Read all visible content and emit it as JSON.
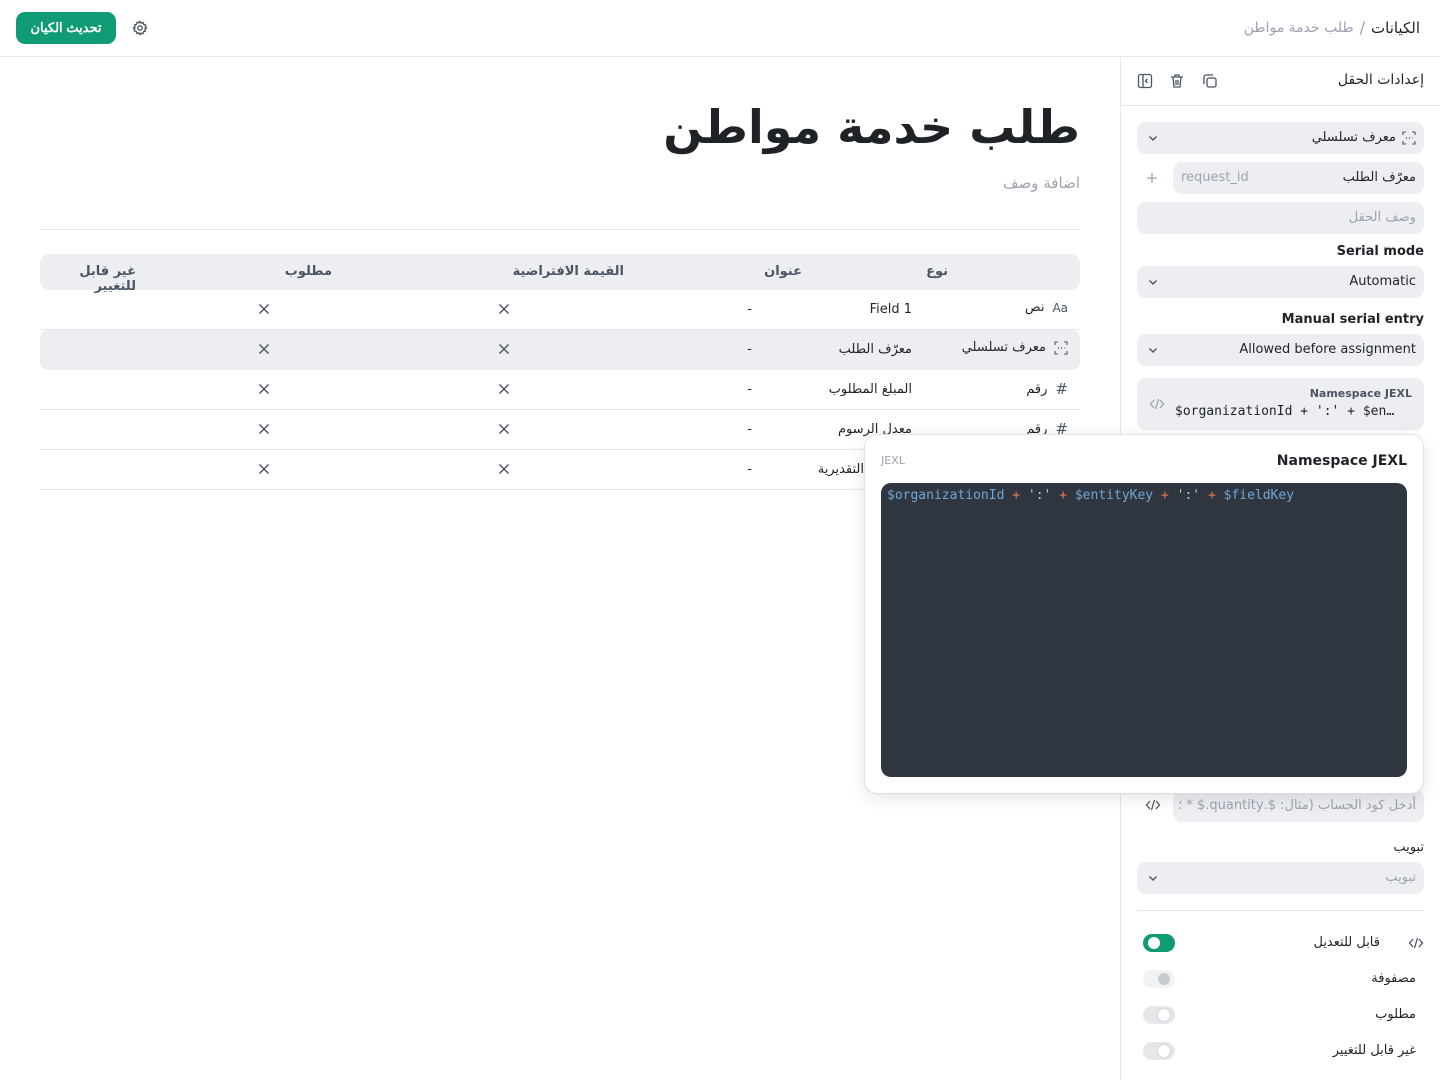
{
  "topbar": {
    "breadcrumb_root": "الكيانات",
    "breadcrumb_sep": "/",
    "breadcrumb_current": "طلب خدمة مواطن",
    "update_button": "تحديث الكيان"
  },
  "main": {
    "title": "طلب خدمة مواطن",
    "description_placeholder": "اضافة وصف"
  },
  "table": {
    "headers": {
      "type": "نوع",
      "title": "عنوان",
      "default": "القيمة الافتراضية",
      "required": "مطلوب",
      "immutable": "غير قابل للتغيير"
    },
    "rows": [
      {
        "type": "نص",
        "icon": "text-type-icon",
        "title": "Field 1",
        "default": "-"
      },
      {
        "type": "معرف تسلسلي",
        "icon": "serial-id-icon",
        "title": "معرّف الطلب",
        "default": "-"
      },
      {
        "type": "رقم",
        "icon": "hash-icon",
        "title": "المبلغ المطلوب",
        "default": "-"
      },
      {
        "type": "رقم",
        "icon": "hash-icon",
        "title": "معدل الرسوم",
        "default": "-"
      },
      {
        "type": "",
        "icon": "",
        "title": "التقديرية",
        "default": "-"
      }
    ]
  },
  "sidepanel": {
    "title": "إعدادات الحقل",
    "field_type": "معرف تسلسلي",
    "field_label": "معرّف الطلب",
    "field_key": "request_id",
    "description_placeholder": "وصف الحقل",
    "serial_mode_label": "Serial mode",
    "serial_mode_value": "Automatic",
    "manual_entry_label": "Manual serial entry",
    "manual_entry_value": "Allowed before assignment",
    "namespace_label": "Namespace JEXL",
    "namespace_value": "$organizationId + ':' + $en…",
    "formula_placeholder": "أدخل كود الحساب (مثال: $.quantity.$ * ؛",
    "tab_label": "تبويب",
    "tab_placeholder": "تبويب",
    "toggles": [
      {
        "label": "قابل للتعديل",
        "state": "on"
      },
      {
        "label": "مصفوفة",
        "state": "disabled"
      },
      {
        "label": "مطلوب",
        "state": "off"
      },
      {
        "label": "غير قابل للتغيير",
        "state": "off"
      }
    ]
  },
  "popover": {
    "title": "Namespace JEXL",
    "language": "JEXL",
    "code_tokens": [
      {
        "t": "var",
        "v": "$organizationId"
      },
      {
        "t": "op",
        "v": "+"
      },
      {
        "t": "str",
        "v": "':'"
      },
      {
        "t": "op",
        "v": "+"
      },
      {
        "t": "var",
        "v": "$entityKey"
      },
      {
        "t": "op",
        "v": "+"
      },
      {
        "t": "str",
        "v": "':'"
      },
      {
        "t": "op",
        "v": "+"
      },
      {
        "t": "var",
        "v": "$fieldKey"
      }
    ]
  },
  "colors": {
    "accent": "#0f9b74",
    "code_bg": "#30363f",
    "muted": "#9ca3af"
  }
}
